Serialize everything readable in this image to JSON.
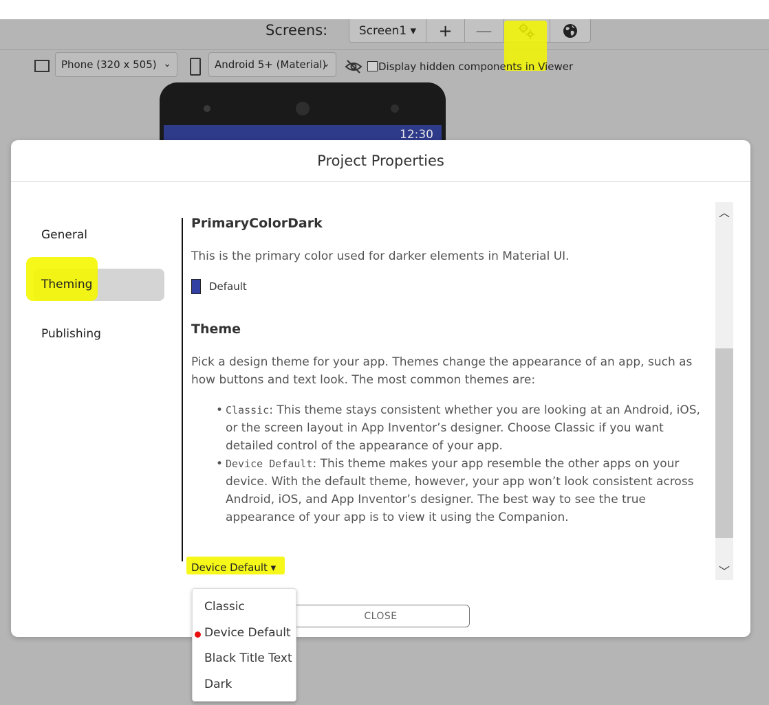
{
  "toolbar": {
    "screens_label": "Screens:",
    "screen_dropdown": "Screen1 ▾",
    "add_label": "+",
    "remove_label": "—"
  },
  "viewer": {
    "phone_size_select": "Phone (320 x 505)",
    "theme_select": "Android 5+ (Material)",
    "hidden_components_label": "Display hidden components in Viewer"
  },
  "phone_preview": {
    "clock": "12:30"
  },
  "modal": {
    "title": "Project Properties",
    "nav": [
      "General",
      "Theming",
      "Publishing"
    ],
    "active_nav": "Theming",
    "primary_color_dark": {
      "heading": "PrimaryColorDark",
      "description": "This is the primary color used for darker elements in Material UI.",
      "swatch_label": "Default",
      "swatch_color": "#3240a3"
    },
    "theme": {
      "heading": "Theme",
      "description": "Pick a design theme for your app. Themes change the appearance of an app, such as how buttons and text look. The most common themes are:",
      "items": [
        {
          "code": "Classic",
          "text": ": This theme stays consistent whether you are looking at an Android, iOS, or the screen layout in App Inventor’s designer. Choose Classic if you want detailed control of the appearance of your app."
        },
        {
          "code": "Device Default",
          "text": ": This theme makes your app resemble the other apps on your device. With the default theme, however, your app won’t look consistent across Android, iOS, and App Inventor’s designer. The best way to see the true appearance of your app is to view it using the Companion."
        }
      ],
      "dropdown_value": "Device Default ▾",
      "options": [
        "Classic",
        "Device Default",
        "Black Title Text",
        "Dark"
      ],
      "selected_option": "Device Default"
    },
    "close_label": "CLOSE"
  },
  "colors": {
    "highlight": "#f4f700",
    "selected_dot": "#e81010"
  }
}
